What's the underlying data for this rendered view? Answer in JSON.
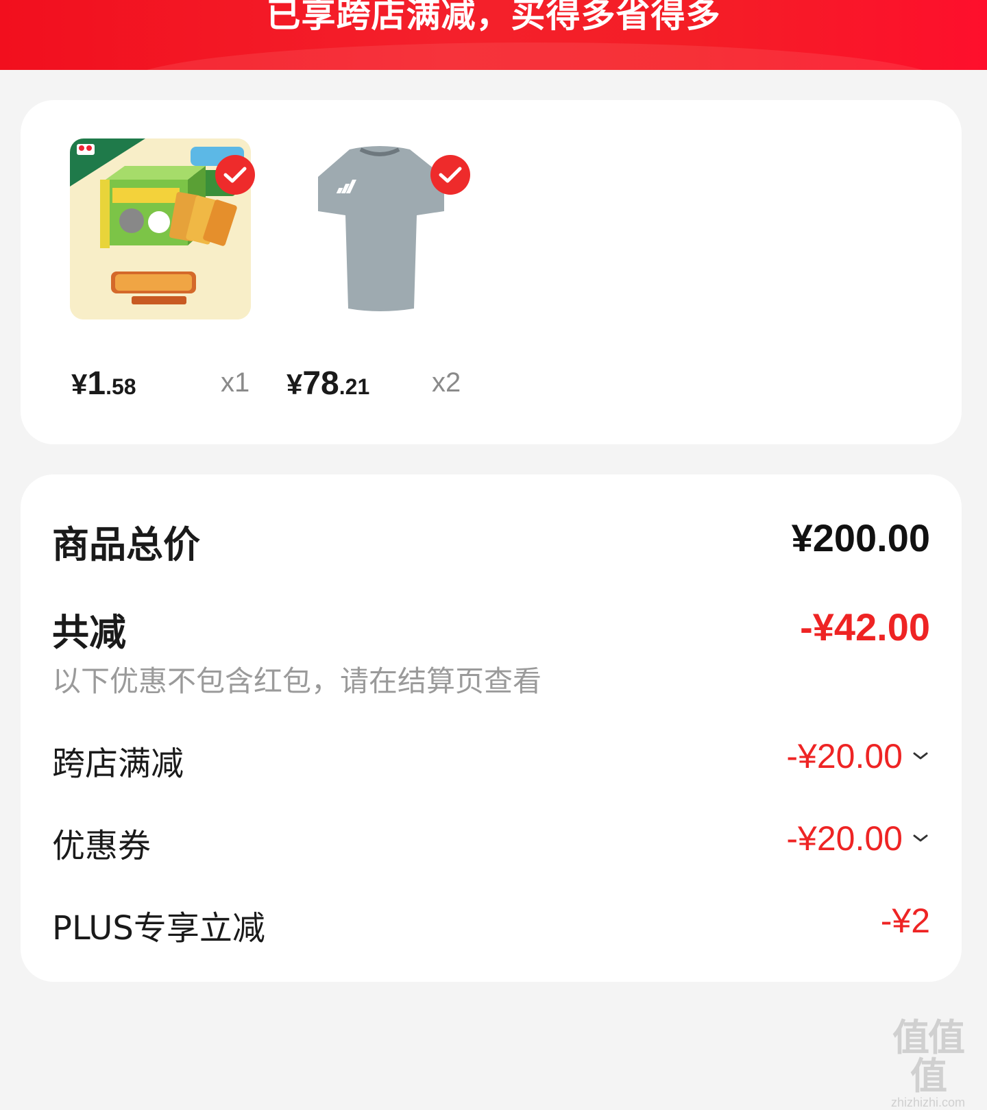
{
  "banner": {
    "title": "已享跨店满减，买得多省得多"
  },
  "products": [
    {
      "name": "toy-card-box",
      "currency": "¥",
      "price_int": "1",
      "price_dec": ".58",
      "qty": "x1",
      "checked": true
    },
    {
      "name": "grey-tshirt",
      "currency": "¥",
      "price_int": "78",
      "price_dec": ".21",
      "qty": "x2",
      "checked": true
    }
  ],
  "summary": {
    "total_label": "商品总价",
    "total_value": "¥200.00",
    "save_label": "共减",
    "save_value": "-¥42.00",
    "note": "以下优惠不包含红包，请在结算页查看",
    "details": [
      {
        "label": "跨店满减",
        "value": "-¥20.00",
        "expandable": true
      },
      {
        "label": "优惠券",
        "value": "-¥20.00",
        "expandable": true
      },
      {
        "label": "PLUS专享立减",
        "value": "-¥2",
        "expandable": false
      }
    ]
  },
  "watermark": {
    "glyphs": "值值值",
    "text": "zhizhizhi.com"
  },
  "colors": {
    "accent_red": "#ee2424",
    "banner_red": "#f4202b",
    "check_red": "#ee2b2b"
  }
}
